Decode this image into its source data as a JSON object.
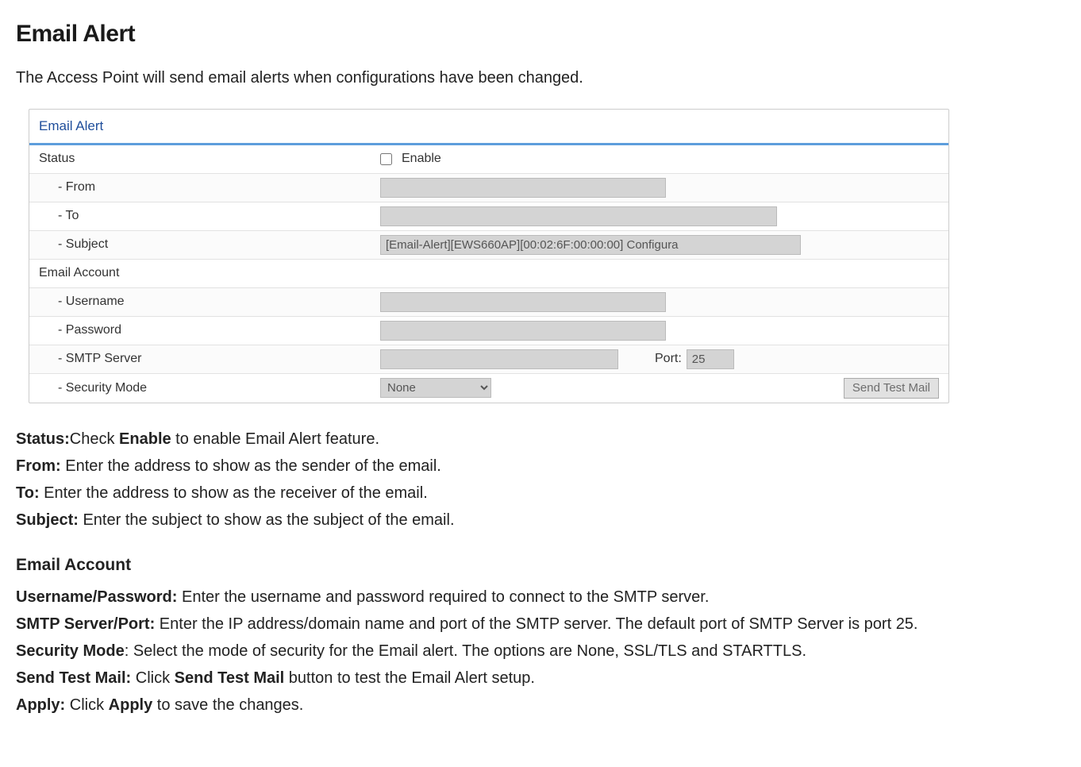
{
  "page": {
    "title": "Email Alert",
    "intro": "The Access Point will send email alerts when configurations have been changed."
  },
  "panel": {
    "heading": "Email Alert",
    "status_label": "Status",
    "enable_label": "Enable",
    "from_label": "- From",
    "to_label": "- To",
    "subject_label": "- Subject",
    "subject_value": "[Email-Alert][EWS660AP][00:02:6F:00:00:00] Configura",
    "email_account_label": "Email Account",
    "username_label": "- Username",
    "password_label": "- Password",
    "smtp_label": "- SMTP Server",
    "port_label": "Port:",
    "port_value": "25",
    "security_label": "- Security Mode",
    "security_value": "None",
    "send_test_label": "Send Test Mail"
  },
  "help": {
    "status": {
      "t": "Status:",
      "b1": "Check ",
      "bold": "Enable",
      "b2": " to enable Email Alert feature."
    },
    "from": {
      "t": "From:",
      "rest": " Enter the address to show as the sender of the email."
    },
    "to": {
      "t": "To:",
      "rest": " Enter the address to show as the receiver of the email."
    },
    "subject": {
      "t": "Subject:",
      "rest": " Enter the subject to show as the subject of the email."
    },
    "section_heading": "Email Account",
    "userpass": {
      "t": "Username/Password:",
      "rest": " Enter the username and password required to connect to the SMTP server."
    },
    "smtp": {
      "t": "SMTP Server/Port:",
      "rest": " Enter the IP address/domain name and port of the SMTP server. The default port of SMTP Server is port 25."
    },
    "secmode": {
      "t": "Security Mode",
      "rest": ": Select the mode of security for the Email alert. The options are None, SSL/TLS and STARTTLS."
    },
    "testmail": {
      "t": "Send Test Mail:",
      "b1": " Click ",
      "bold": "Send Test Mail",
      "b2": " button to test the Email Alert setup."
    },
    "apply": {
      "t": "Apply:",
      "b1": " Click ",
      "bold": "Apply",
      "b2": " to save the changes."
    }
  }
}
